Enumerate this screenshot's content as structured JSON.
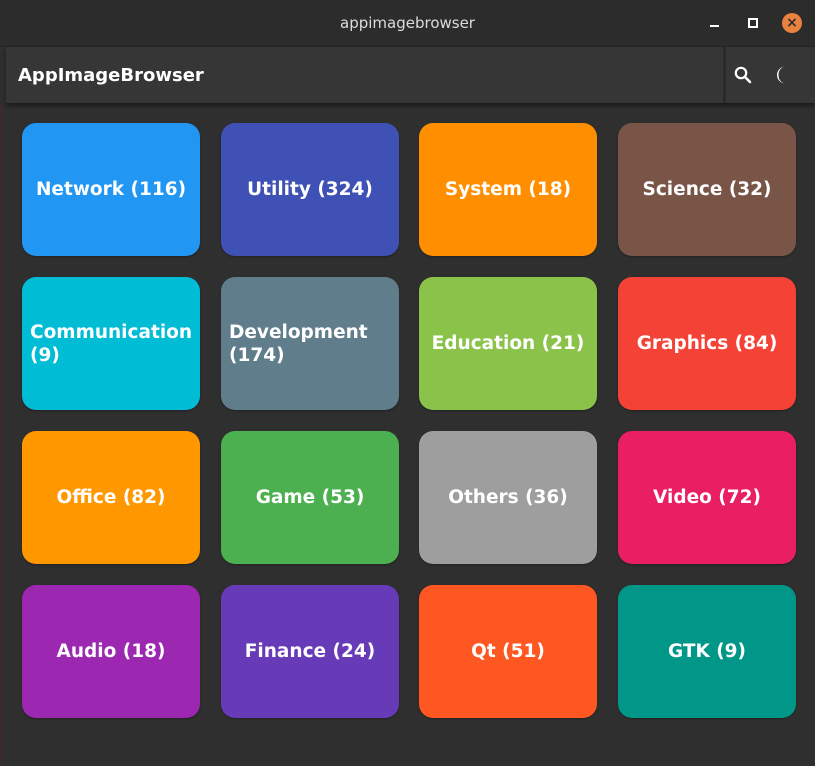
{
  "window": {
    "title": "appimagebrowser",
    "controls": {
      "minimize_icon": "minimize-icon",
      "maximize_icon": "maximize-icon",
      "close_icon": "close-icon",
      "close_color": "#e9823f"
    }
  },
  "appbar": {
    "title": "AppImageBrowser",
    "search_icon": "search-icon",
    "theme_icon": "moon-icon"
  },
  "categories": [
    {
      "label": "Network (116)",
      "color": "#2196f3"
    },
    {
      "label": "Utility (324)",
      "color": "#3f51b5"
    },
    {
      "label": "System (18)",
      "color": "#ff8f00"
    },
    {
      "label": "Science (32)",
      "color": "#795548"
    },
    {
      "label": "Communication (9)",
      "color": "#00bcd4"
    },
    {
      "label": "Development (174)",
      "color": "#607d8b"
    },
    {
      "label": "Education (21)",
      "color": "#8bc34a"
    },
    {
      "label": "Graphics (84)",
      "color": "#f44336"
    },
    {
      "label": "Office (82)",
      "color": "#ff9800"
    },
    {
      "label": "Game (53)",
      "color": "#4caf50"
    },
    {
      "label": "Others (36)",
      "color": "#9e9e9e"
    },
    {
      "label": "Video (72)",
      "color": "#e91e63"
    },
    {
      "label": "Audio (18)",
      "color": "#9c27b0"
    },
    {
      "label": "Finance (24)",
      "color": "#673ab7"
    },
    {
      "label": "Qt (51)",
      "color": "#ff5722"
    },
    {
      "label": "GTK (9)",
      "color": "#009688"
    }
  ]
}
